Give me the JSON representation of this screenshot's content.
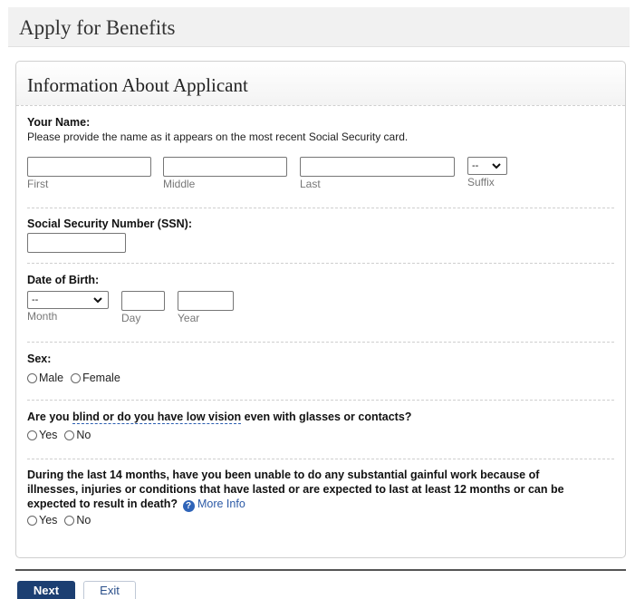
{
  "page": {
    "title": "Apply for Benefits"
  },
  "panel": {
    "title": "Information About Applicant"
  },
  "name_section": {
    "label": "Your Name:",
    "help": "Please provide the name as it appears on the most recent Social Security card.",
    "fields": {
      "first": "First",
      "middle": "Middle",
      "last": "Last",
      "suffix": "Suffix"
    },
    "suffix_value": "--"
  },
  "ssn_section": {
    "label": "Social Security Number (SSN):"
  },
  "dob_section": {
    "label": "Date of Birth:",
    "month_value": "--",
    "fields": {
      "month": "Month",
      "day": "Day",
      "year": "Year"
    }
  },
  "sex_section": {
    "label": "Sex:",
    "options": [
      "Male",
      "Female"
    ]
  },
  "blind_section": {
    "label_pre": "Are you ",
    "label_link": "blind or do you have low vision",
    "label_post": " even with glasses or contacts?",
    "options": [
      "Yes",
      "No"
    ]
  },
  "work_section": {
    "label": "During the last 14 months, have you been unable to do any substantial gainful work because of illnesses, injuries or conditions that have lasted or are expected to last at least 12 months or can be expected to result in death?",
    "help_icon": "question-circle-icon",
    "more_info": "More Info",
    "options": [
      "Yes",
      "No"
    ]
  },
  "footer": {
    "next": "Next",
    "exit": "Exit"
  },
  "colors": {
    "primary_button": "#1c3f72",
    "link": "#2c5aa6",
    "help_icon": "#2e63b8"
  }
}
